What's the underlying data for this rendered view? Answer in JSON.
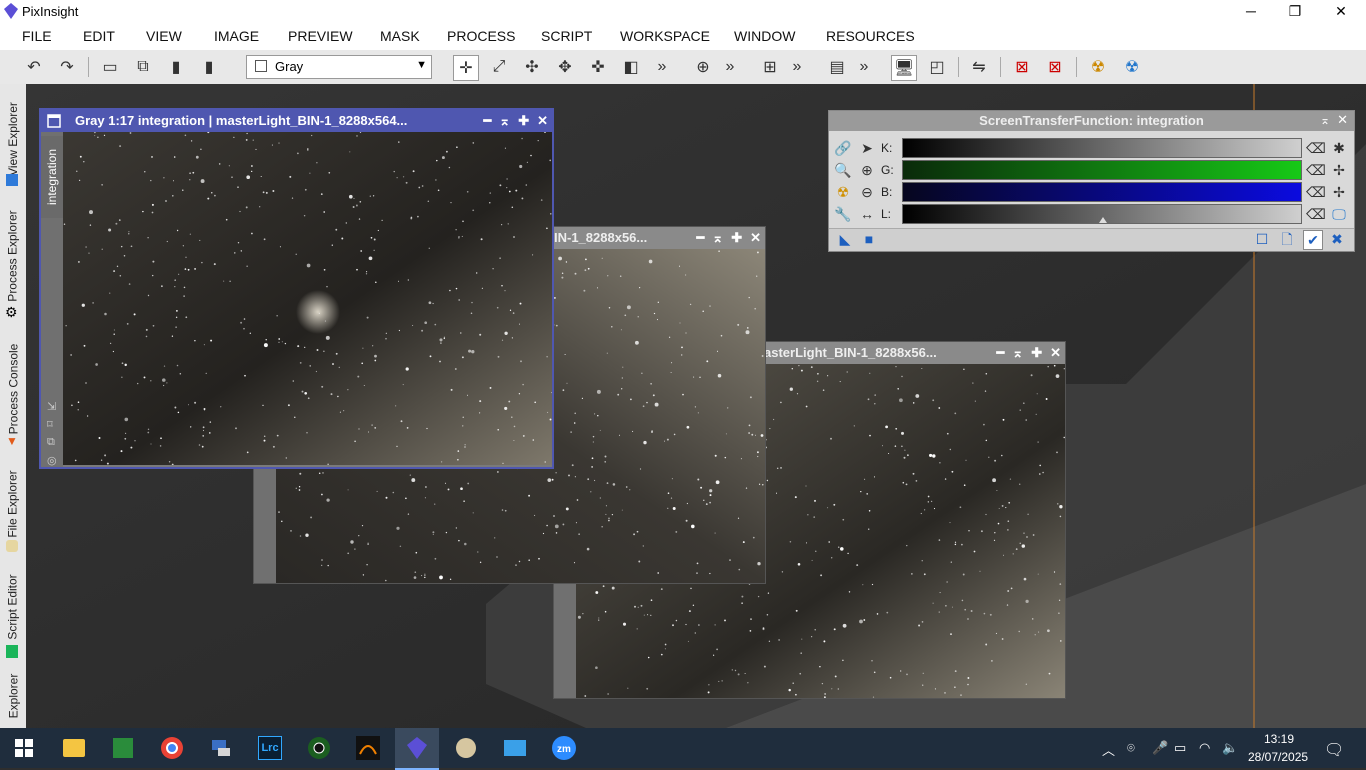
{
  "app": {
    "title": "PixInsight"
  },
  "window_controls": {
    "minimize": "─",
    "maximize": "❐",
    "close": "✕"
  },
  "menu": [
    "FILE",
    "EDIT",
    "VIEW",
    "IMAGE",
    "PREVIEW",
    "MASK",
    "PROCESS",
    "SCRIPT",
    "WORKSPACE",
    "WINDOW",
    "RESOURCES"
  ],
  "toolbar": {
    "color_mode_selected": "Gray",
    "overflow": "»"
  },
  "side_tabs": [
    "View Explorer",
    "Process Explorer",
    "Process Console",
    "File Explorer",
    "Script Editor",
    "Explorer"
  ],
  "image_windows": [
    {
      "title": "Gray 1:17 integration | masterLight_BIN-1_8288x564...",
      "view_tab": "integration"
    },
    {
      "title": "IN-1_8288x56..."
    },
    {
      "title": "asterLight_BIN-1_8288x56..."
    }
  ],
  "stf": {
    "title": "ScreenTransferFunction: integration",
    "channels": [
      {
        "label": "K:",
        "gradient_end": "#cfcfcf",
        "gradient_start": "#000000"
      },
      {
        "label": "G:",
        "gradient_end": "#16c916",
        "gradient_start": "#0a2a0a"
      },
      {
        "label": "B:",
        "gradient_end": "#0b0bdf",
        "gradient_start": "#06061e"
      },
      {
        "label": "L:",
        "gradient_end": "#cfcfcf",
        "gradient_start": "#000000"
      }
    ]
  },
  "taskbar": {
    "time": "13:19",
    "date": "28/07/2025"
  },
  "colors": {
    "accent": "#4f57b0",
    "taskbar": "#1f2d3d",
    "orange_guide": "#c77a2a"
  }
}
